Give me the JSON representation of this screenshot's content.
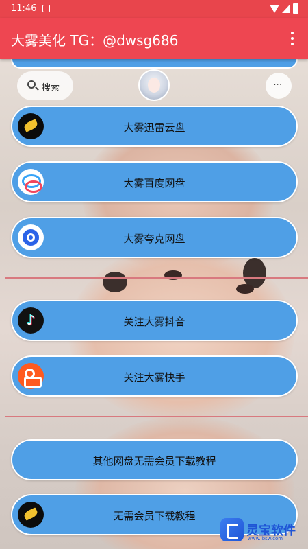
{
  "status_bar": {
    "time": "11:46"
  },
  "app_bar": {
    "title": "大雾美化 TG：@dwsg686"
  },
  "top_bar": {
    "search_label": "搜索",
    "more_label": "···"
  },
  "buttons": [
    {
      "label": "大雾迅雷云盘",
      "icon": "thunder-bird-icon"
    },
    {
      "label": "大雾百度网盘",
      "icon": "baidu-netdisk-icon"
    },
    {
      "label": "大雾夸克网盘",
      "icon": "quark-icon"
    },
    {
      "label": "关注大雾抖音",
      "icon": "tiktok-icon"
    },
    {
      "label": "关注大雾快手",
      "icon": "kuaishou-icon"
    },
    {
      "label": "其他网盘无需会员下载教程",
      "icon": ""
    },
    {
      "label": "无需会员下载教程",
      "icon": "thunder-bird-icon"
    }
  ],
  "watermark": {
    "text": "灵宝软件",
    "sub": "www.lbsw.com"
  },
  "colors": {
    "app_bar": "#ee4651",
    "button": "#4f9fe6",
    "button_border": "#ffffff"
  }
}
